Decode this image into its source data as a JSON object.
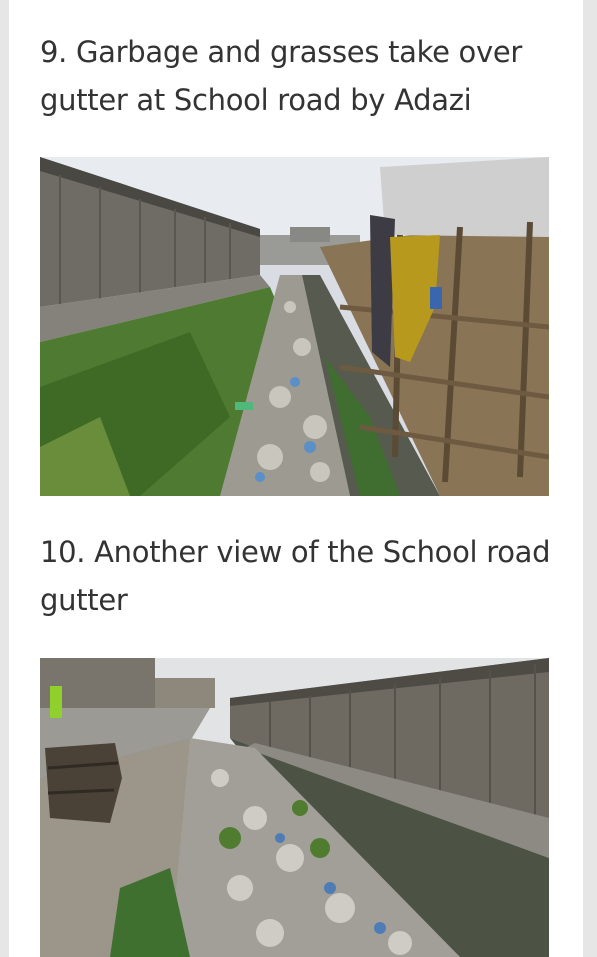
{
  "article": {
    "items": [
      {
        "title": "9. Garbage and grasses take over gutter at School road by Adazi",
        "image_alt": "Garbage-filled gutter overgrown with grass beside wooden market stalls"
      },
      {
        "title": "10. Another view of the School road gutter",
        "image_alt": "Long gutter filled with garbage running past a row of wooden shops"
      }
    ]
  },
  "colors": {
    "page_background": "#ffffff",
    "outer_background": "#e6e6e6",
    "heading_text": "#333333"
  }
}
